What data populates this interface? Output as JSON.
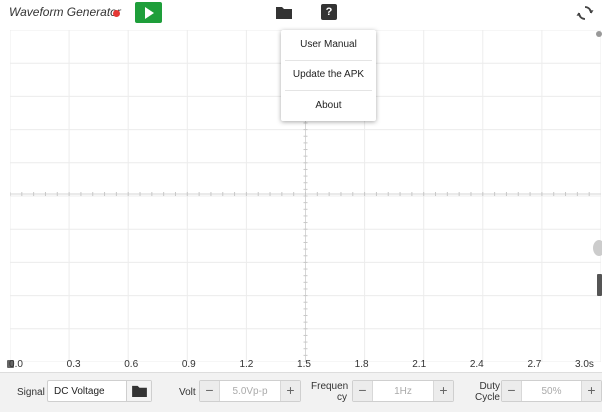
{
  "app": {
    "title": "Waveform Generator"
  },
  "toolbar": {
    "play_icon": "play-icon",
    "folder_icon": "folder-icon",
    "help_icon": "help-icon",
    "help_glyph": "?",
    "refresh_icon": "refresh-icon",
    "accent_color": "#1e9e3a",
    "alert_color": "#e53935"
  },
  "menu": {
    "items": [
      {
        "label": "User Manual"
      },
      {
        "label": "Update the APK"
      },
      {
        "label": "About"
      }
    ]
  },
  "axis": {
    "ticks": [
      "0.0",
      "0.3",
      "0.6",
      "0.9",
      "1.2",
      "1.5",
      "1.8",
      "2.1",
      "2.4",
      "2.7",
      "3.0s"
    ]
  },
  "controls": {
    "signal": {
      "label": "Signal",
      "value": "DC Voltage"
    },
    "volt": {
      "label": "Volt",
      "value": "5.0Vp-p",
      "minus": "−",
      "plus": "+"
    },
    "frequency": {
      "label_line1": "Frequen",
      "label_line2": "cy",
      "value": "1Hz",
      "minus": "−",
      "plus": "+"
    },
    "duty": {
      "label_line1": "Duty",
      "label_line2": "Cycle",
      "value": "50%",
      "minus": "−",
      "plus": "+"
    }
  }
}
